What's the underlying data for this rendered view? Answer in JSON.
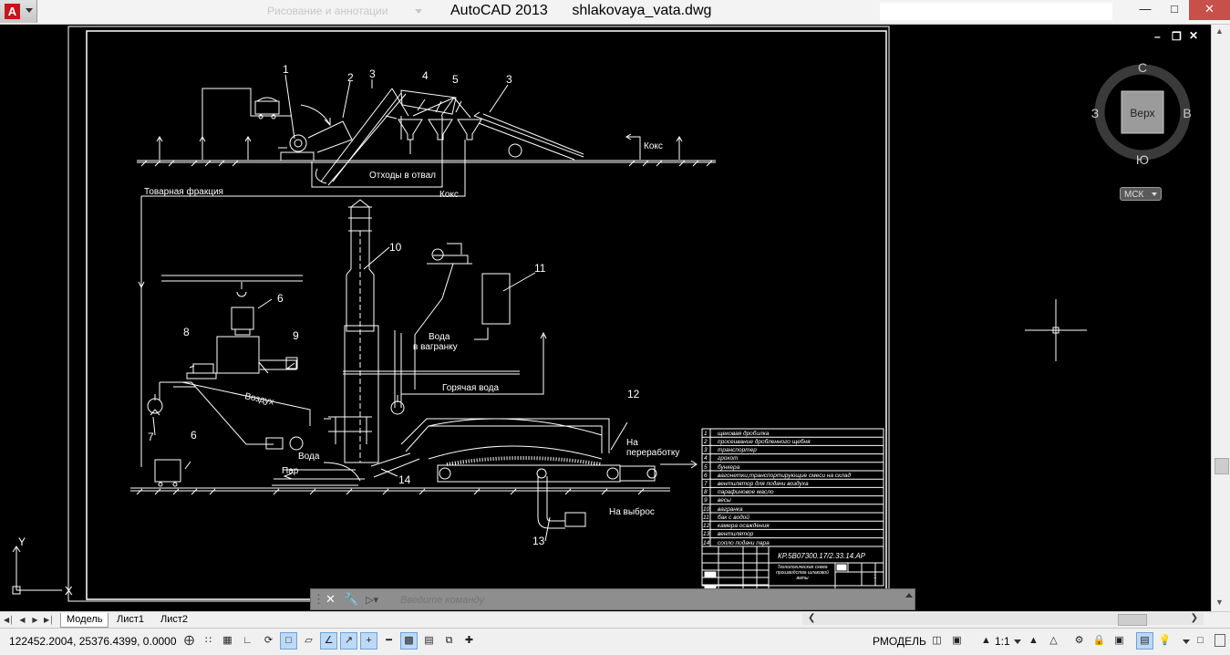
{
  "titlebar": {
    "app_name": "AutoCAD 2013",
    "file_name": "shlakovaya_vata.dwg",
    "workspace": "Рисование и аннотации"
  },
  "viewcube": {
    "top_face": "Верх",
    "north": "С",
    "south": "Ю",
    "east": "В",
    "west": "З",
    "ucs": "МСК"
  },
  "drawing": {
    "callouts": [
      "1",
      "2",
      "3",
      "4",
      "5",
      "3",
      "10",
      "6",
      "11",
      "8",
      "9",
      "7",
      "6",
      "12",
      "14",
      "13"
    ],
    "labels": {
      "coke_top": "Кокс",
      "waste": "Отходы в отвал",
      "commodity": "Товарная фракция",
      "coke_mid": "Кокс",
      "water_to_cupola_1": "Вода",
      "water_to_cupola_2": "в вагранку",
      "hot_water": "Горячая вода",
      "air": "Воздух",
      "water": "Вода",
      "steam": "Пар",
      "reprocess_1": "На",
      "reprocess_2": "переработку",
      "discharge": "На выброс"
    },
    "spec_rows": [
      {
        "n": "1",
        "t": "щековая дробилка"
      },
      {
        "n": "2",
        "t": "просеивание дробленного щебня"
      },
      {
        "n": "3",
        "t": "транспортер"
      },
      {
        "n": "4",
        "t": "грохот"
      },
      {
        "n": "5",
        "t": "бункера"
      },
      {
        "n": "6",
        "t": "вагонетки,транспортирующие смеси на склад"
      },
      {
        "n": "7",
        "t": "вентилятор для подачи воздуха"
      },
      {
        "n": "8",
        "t": "парафиновое масло"
      },
      {
        "n": "9",
        "t": "весы"
      },
      {
        "n": "10",
        "t": "вагранка"
      },
      {
        "n": "11",
        "t": "бак с водой"
      },
      {
        "n": "12",
        "t": "камера осаждения"
      },
      {
        "n": "13",
        "t": "вентилятор"
      },
      {
        "n": "14",
        "t": "сопло подачи пара"
      }
    ],
    "stamp_code": "КР.5В07300.17/2.33.14.АР",
    "stamp_title": "Технологическая схема производства шлаковой ваты",
    "stamp_sheet": "1"
  },
  "ucs_icon": {
    "x": "X",
    "y": "Y"
  },
  "command_line": {
    "placeholder": "Введите команду"
  },
  "layout_tabs": {
    "model": "Модель",
    "sheet1": "Лист1",
    "sheet2": "Лист2"
  },
  "statusbar": {
    "coordinates": "122452.2004, 25376.4399, 0.0000",
    "space": "РМОДЕЛЬ",
    "scale": "1:1"
  }
}
